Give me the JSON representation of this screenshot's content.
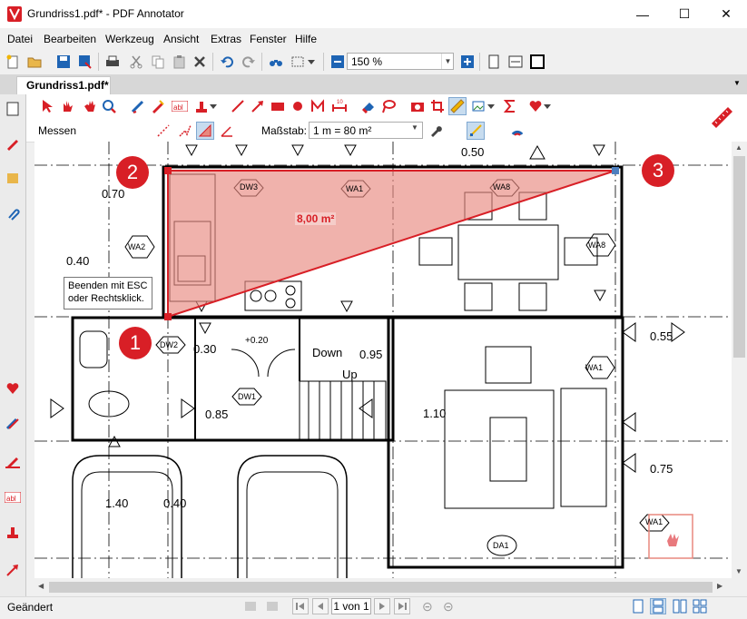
{
  "window": {
    "title": "Grundriss1.pdf* - PDF Annotator",
    "controls": {
      "minimize": "—",
      "maximize": "☐",
      "close": "✕"
    }
  },
  "menu": [
    {
      "label": "Datei"
    },
    {
      "label": "Bearbeiten"
    },
    {
      "label": "Werkzeug"
    },
    {
      "label": "Ansicht"
    },
    {
      "label": "Extras"
    },
    {
      "label": "Fenster"
    },
    {
      "label": "Hilfe"
    }
  ],
  "toolbar": {
    "zoom_value": "150 %"
  },
  "tab": {
    "label": "Grundriss1.pdf*"
  },
  "annotation_toolbar": {
    "mode_label": "Messen",
    "scale_label": "Maßstab:",
    "scale_value": "1 m = 80 m²"
  },
  "measurement": {
    "area_label": "8,00 m²",
    "points": [
      "1",
      "2",
      "3"
    ],
    "hint_line1": "Beenden mit ESC",
    "hint_line2": "oder Rechtsklick."
  },
  "floorplan_labels": {
    "d070": "0.70",
    "d040": "0.40",
    "d050": "0.50",
    "d030": "0.30",
    "d095": "0.95",
    "d085": "0.85",
    "d110": "1.10",
    "d055": "0.55",
    "d075": "0.75",
    "d140": "1.40",
    "d040b": "0.40",
    "d020": "+0.20",
    "down": "Down",
    "up": "Up",
    "dw3": "DW3",
    "wa1": "WA1",
    "wa8": "WA8",
    "wa8b": "WA8",
    "wa2": "WA2",
    "dw2": "DW2",
    "dw1": "DW1",
    "wa1b": "WA1",
    "wa1c": "WA1",
    "da1": "DA1"
  },
  "status": {
    "left": "Geändert",
    "page": "1 von 1"
  },
  "colors": {
    "accent_red": "#d81f26",
    "area_fill": "#e8897f",
    "toolbar_blue": "#1e64b4"
  }
}
